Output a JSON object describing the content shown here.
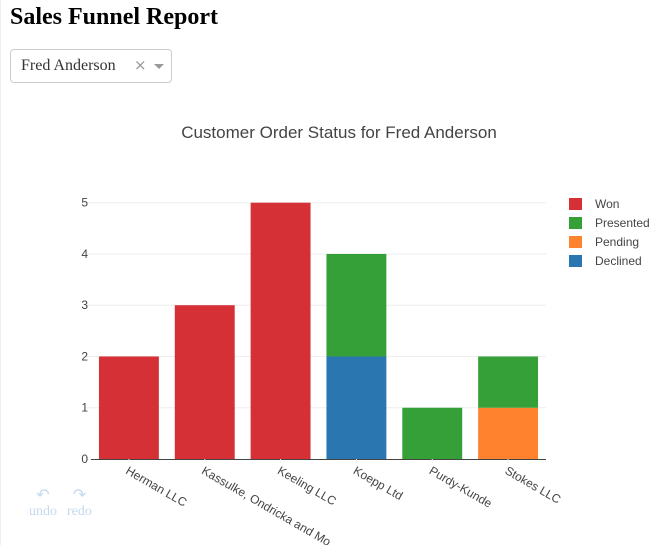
{
  "page": {
    "title": "Sales Funnel Report"
  },
  "dropdown": {
    "selected": "Fred Anderson",
    "clear_icon": "×"
  },
  "modebar": {
    "undo_label": "undo",
    "redo_label": "redo",
    "undo_icon": "↶",
    "redo_icon": "↷"
  },
  "chart_data": {
    "type": "bar",
    "barmode": "stack",
    "title": "Customer Order Status for Fred Anderson",
    "xlabel": "",
    "ylabel": "",
    "categories": [
      "Herman LLC",
      "Kassulke, Ondricka and Metz",
      "Keeling LLC",
      "Koepp Ltd",
      "Purdy-Kunde",
      "Stokes LLC"
    ],
    "category_labels_visible": [
      "Herman LLC",
      "Kassulke, Ondricka and Mo",
      "Keeling LLC",
      "Koepp Ltd",
      "Purdy-Kunde",
      "Stokes LLC"
    ],
    "series": [
      {
        "name": "Declined",
        "color": "#2a76b1",
        "values": [
          0,
          0,
          0,
          2,
          0,
          0
        ]
      },
      {
        "name": "Pending",
        "color": "#ff832f",
        "values": [
          0,
          0,
          0,
          0,
          0,
          1
        ]
      },
      {
        "name": "Presented",
        "color": "#36a038",
        "values": [
          0,
          0,
          0,
          2,
          1,
          1
        ]
      },
      {
        "name": "Won",
        "color": "#d43035",
        "values": [
          2,
          3,
          5,
          0,
          0,
          0
        ]
      }
    ],
    "legend_order": [
      "Won",
      "Presented",
      "Pending",
      "Declined"
    ],
    "yticks": [
      0,
      1,
      2,
      3,
      4,
      5
    ],
    "ylim": [
      0,
      5.25
    ],
    "grid": true,
    "legend_position": "right"
  }
}
